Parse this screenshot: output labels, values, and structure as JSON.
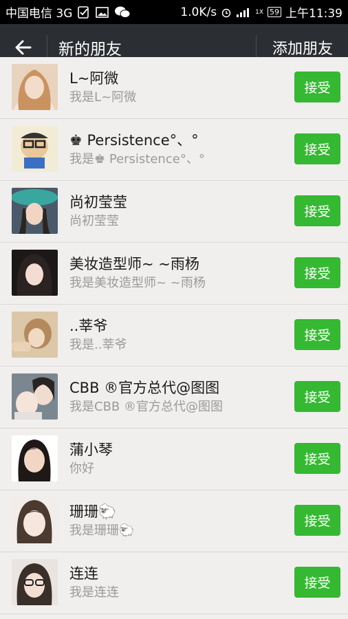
{
  "status_bar": {
    "carrier": "中国电信 3G",
    "speed": "1.0K/s",
    "network_label": "1X",
    "battery": "59",
    "time": "上午11:39",
    "icons": [
      "sim-icon",
      "image-icon",
      "wechat-icon",
      "alarm-icon",
      "signal-icon",
      "battery-icon"
    ]
  },
  "header": {
    "title": "新的朋友",
    "add_label": "添加朋友"
  },
  "colors": {
    "header_bg": "#2b2e33",
    "accent_green": "#35b832",
    "list_bg": "#f0efed"
  },
  "requests": [
    {
      "name": "L~阿微",
      "message": "我是L~阿微",
      "action": "接受"
    },
    {
      "name": "♚ Persistence°、°",
      "message": "我是♚ Persistence°、°",
      "action": "接受"
    },
    {
      "name": "尚初莹莹",
      "message": "尚初莹莹",
      "action": "接受"
    },
    {
      "name": "美妆造型师~ ~雨杨",
      "message": "我是美妆造型师~ ~雨杨",
      "action": "接受"
    },
    {
      "name": "..莘爷",
      "message": "我是..莘爷",
      "action": "接受"
    },
    {
      "name": "CBB ®官方总代@图图",
      "message": "我是CBB ®官方总代@图图",
      "action": "接受"
    },
    {
      "name": "蒲小琴",
      "message": "你好",
      "action": "接受"
    },
    {
      "name": "珊珊🐑",
      "message": "我是珊珊🐑",
      "action": "接受"
    },
    {
      "name": "连连",
      "message": "我是连连",
      "action": "接受"
    }
  ]
}
